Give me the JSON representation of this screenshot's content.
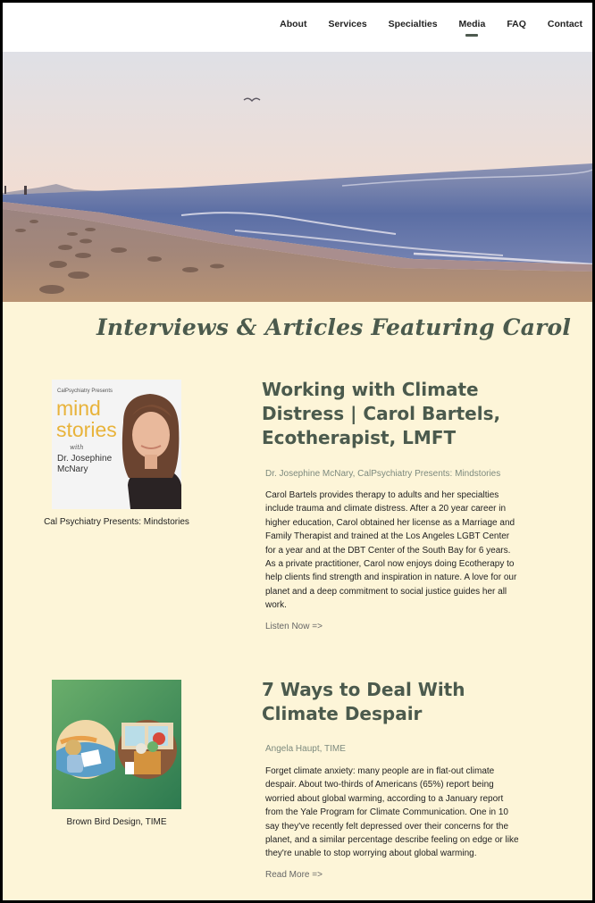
{
  "nav": {
    "items": [
      {
        "label": "About"
      },
      {
        "label": "Services"
      },
      {
        "label": "Specialties"
      },
      {
        "label": "Media"
      },
      {
        "label": "FAQ"
      },
      {
        "label": "Contact"
      }
    ],
    "active": "Media"
  },
  "section": {
    "title": "Interviews & Articles Featuring Carol"
  },
  "articles": [
    {
      "title": "Working with Climate Distress | Carol Bartels, Ecotherapist, LMFT",
      "author": "Dr. Josephine McNary, CalPsychiatry Presents: Mindstories",
      "body": "Carol Bartels provides therapy to adults and her specialties include trauma and climate distress. After a 20 year career in higher education, Carol obtained her license as a Marriage and Family Therapist and trained at the Los Angeles LGBT Center for a year and at the DBT Center of the South Bay for 6 years. As a private practitioner, Carol now enjoys doing Ecotherapy to help clients find strength and inspiration in nature. A love for our planet and a deep commitment to social justice guides her all work.",
      "link": "Listen Now =>",
      "caption": "Cal Psychiatry Presents: Mindstories",
      "thumb": {
        "small": "CalPsychiatry Presents",
        "line1": "mind",
        "line2": "stories",
        "with": "with",
        "name1": "Dr. Josephine",
        "name2": "McNary"
      }
    },
    {
      "title": "7 Ways to Deal With Climate Despair",
      "author": "Angela Haupt, TIME",
      "body": "Forget climate anxiety: many people are in flat-out climate despair. About two-thirds of Americans (65%) report being worried about global warming, according to a January report from the Yale Program for Climate Communication. One in 10 say they've recently felt depressed over their concerns for the planet, and a similar percentage describe feeling on edge or like they're unable to stop worrying about global warming.",
      "link": "Read More =>",
      "caption": "Brown Bird Design, TIME"
    }
  ],
  "colors": {
    "background": "#fdf5d8",
    "title_green": "#4b5a4d",
    "thumb_yellow": "#e8b33a",
    "time_green": "#3d8a5c"
  }
}
